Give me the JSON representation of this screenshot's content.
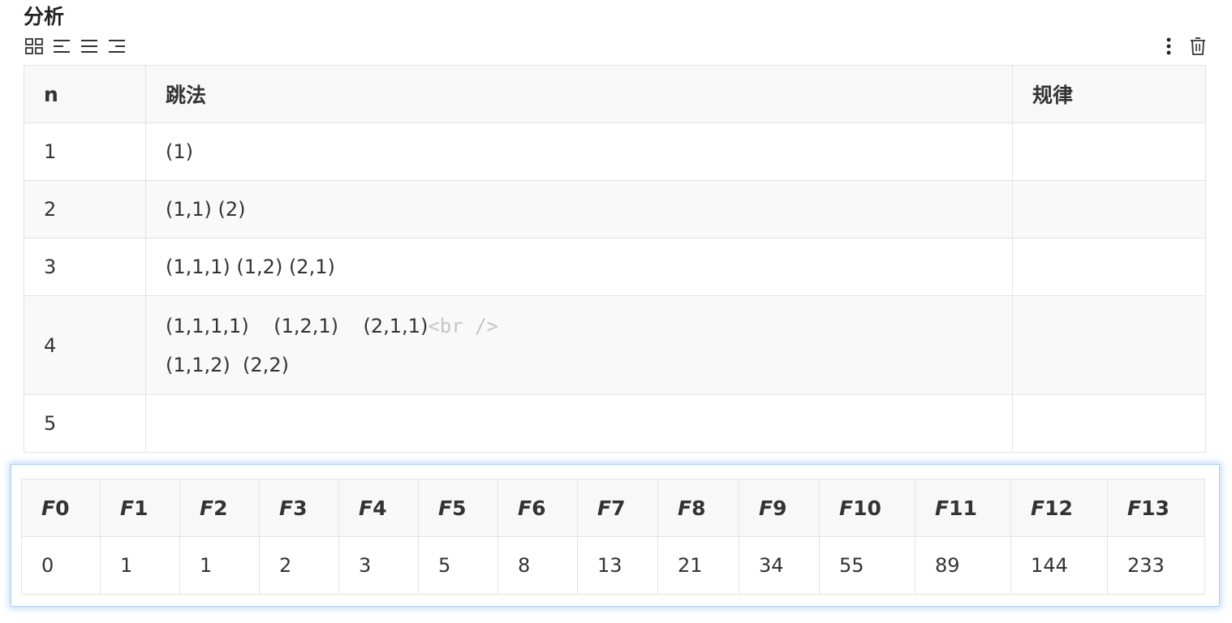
{
  "heading": "分析",
  "toolbar": {
    "left_icons": [
      "table-grid-icon",
      "align-left-icon",
      "align-center-icon",
      "align-right-icon"
    ],
    "right_icons": [
      "more-vertical-icon",
      "trash-icon"
    ]
  },
  "table1": {
    "headers": [
      "n",
      "跳法",
      "规律"
    ],
    "rows": [
      {
        "n": "1",
        "line1": "(1)",
        "line2": "",
        "rule": ""
      },
      {
        "n": "2",
        "line1": "(1,1)  (2)",
        "line2": "",
        "rule": ""
      },
      {
        "n": "3",
        "line1": "(1,1,1)  (1,2)  (2,1)",
        "line2": "",
        "rule": ""
      },
      {
        "n": "4",
        "line1": "(1,1,1,1)    (1,2,1)    (2,1,1)",
        "br_tag": "<br />",
        "line2": "(1,1,2)  (2,2)",
        "rule": ""
      },
      {
        "n": "5",
        "line1": "",
        "line2": "",
        "rule": ""
      }
    ]
  },
  "fib_table": {
    "headers": [
      {
        "letter": "F",
        "index": "0"
      },
      {
        "letter": "F",
        "index": "1"
      },
      {
        "letter": "F",
        "index": "2"
      },
      {
        "letter": "F",
        "index": "3"
      },
      {
        "letter": "F",
        "index": "4"
      },
      {
        "letter": "F",
        "index": "5"
      },
      {
        "letter": "F",
        "index": "6"
      },
      {
        "letter": "F",
        "index": "7"
      },
      {
        "letter": "F",
        "index": "8"
      },
      {
        "letter": "F",
        "index": "9"
      },
      {
        "letter": "F",
        "index": "10"
      },
      {
        "letter": "F",
        "index": "11"
      },
      {
        "letter": "F",
        "index": "12"
      },
      {
        "letter": "F",
        "index": "13"
      }
    ],
    "values": [
      "0",
      "1",
      "1",
      "2",
      "3",
      "5",
      "8",
      "13",
      "21",
      "34",
      "55",
      "89",
      "144",
      "233"
    ]
  },
  "colors": {
    "border": "#e3e3e3",
    "header_bg": "#f8f8f8",
    "selection_border": "#a9cdf2",
    "br_tag": "#c5c5c5"
  }
}
